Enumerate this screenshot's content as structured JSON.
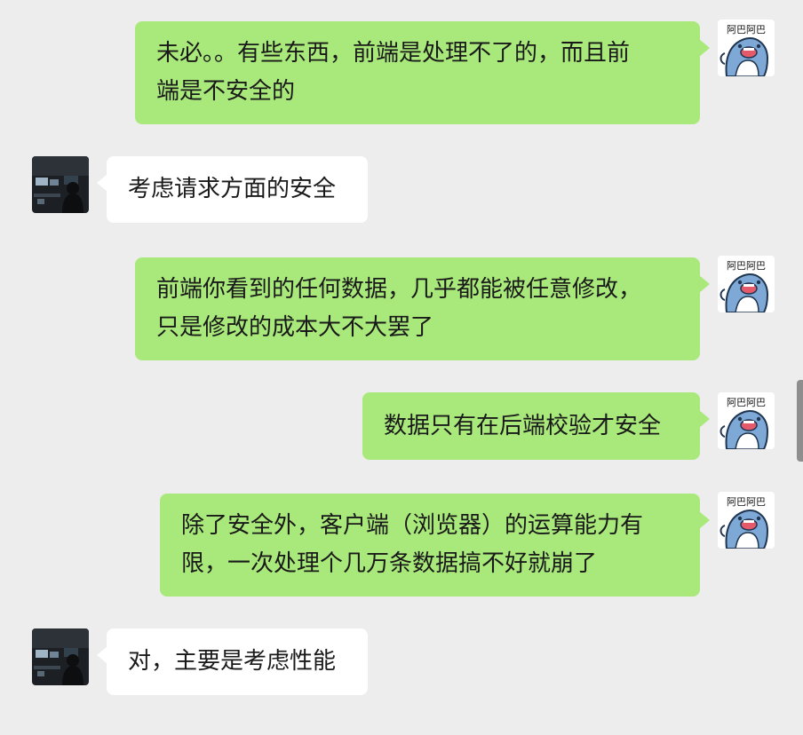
{
  "messages": [
    {
      "side": "right",
      "text": "未必。。有些东西，前端是处理不了的，而且前\n端是不安全的"
    },
    {
      "side": "left",
      "text": "考虑请求方面的安全"
    },
    {
      "side": "right",
      "text": "前端你看到的任何数据，几乎都能被任意修改，\n只是修改的成本大不大罢了"
    },
    {
      "side": "right",
      "text": "数据只有在后端校验才安全"
    },
    {
      "side": "right",
      "text": "除了安全外，客户端（浏览器）的运算能力有\n限，一次处理个几万条数据搞不好就崩了"
    },
    {
      "side": "left",
      "text": "对，主要是考虑性能"
    }
  ],
  "avatars": {
    "self": {
      "caption": "阿巴阿巴",
      "icon": "dolphin-sticker-icon"
    },
    "other": {
      "icon": "dark-room-photo-icon"
    }
  },
  "colors": {
    "background": "#ededed",
    "sent_bubble": "#a9e97b",
    "received_bubble": "#ffffff",
    "text": "#191919"
  }
}
